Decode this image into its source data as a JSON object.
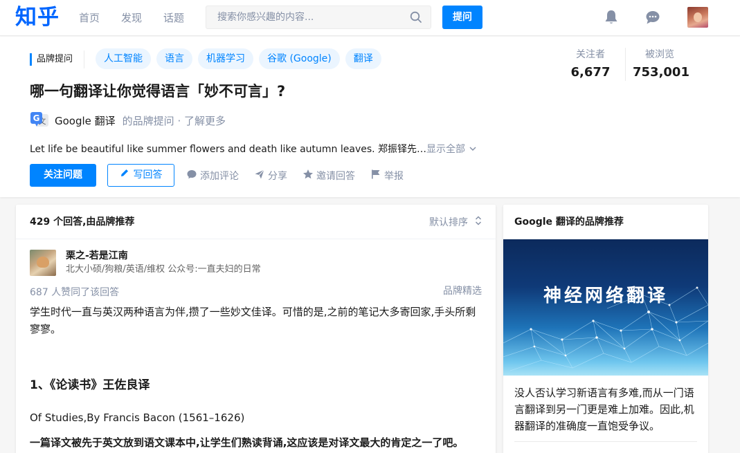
{
  "nav": {
    "logo": "知乎",
    "links": [
      "首页",
      "发现",
      "话题"
    ],
    "search_placeholder": "搜索你感兴趣的内容...",
    "ask_label": "提问"
  },
  "question": {
    "brand_tag": "品牌提问",
    "topics": [
      "人工智能",
      "语言",
      "机器学习",
      "谷歌 (Google)",
      "翻译"
    ],
    "title": "哪一句翻译让你觉得语言「妙不可言」?",
    "brand_name": "Google 翻译",
    "brand_note": "的品牌提问 · 了解更多",
    "excerpt": "Let life be beautiful like summer flowers and death like autumn leaves. 郑振铎先…",
    "show_all": "显示全部",
    "follow_label": "关注问题",
    "write_label": "写回答",
    "actions": [
      "添加评论",
      "分享",
      "邀请回答",
      "举报"
    ],
    "followers_label": "关注者",
    "followers_count": "6,677",
    "views_label": "被浏览",
    "views_count": "753,001"
  },
  "answers": {
    "count_text": "429 个回答,由品牌推荐",
    "sort_label": "默认排序",
    "author_name": "栗之-若是江南",
    "author_bio": "北大小硕/狗粮/英语/维权 公众号:一直夫妇的日常",
    "votes_text": "687 人赞同了该回答",
    "featured_label": "品牌精选",
    "paragraph1": "学生时代一直与英汉两种语言为伴,攒了一些妙文佳译。可惜的是,之前的笔记大多寄回家,手头所剩寥寥。",
    "heading1": "1、《论读书》王佐良译",
    "paragraph2": "Of Studies,By Francis Bacon (1561–1626)",
    "paragraph3": "一篇译文被先于英文放到语文课本中,让学生们熟读背诵,这应该是对译文最大的肯定之一了吧。"
  },
  "side": {
    "title": "Google 翻译的品牌推荐",
    "banner_text": "神经网络翻译",
    "description": "没人否认学习新语言有多难,而从一门语言翻译到另一门更是难上加难。因此,机器翻译的准确度一直饱受争议。"
  },
  "colors": {
    "brand_blue": "#0084ff",
    "logo_blue": "#0066ff",
    "muted_gray": "#8590a6",
    "topic_bg": "#ebf5ff"
  },
  "icons": {
    "search": "search-icon",
    "bell": "bell-icon",
    "chat": "chat-icon",
    "pencil": "pencil-icon",
    "comment": "comment-icon",
    "share": "share-icon",
    "invite": "star-icon",
    "report": "flag-icon",
    "sort": "sort-icon",
    "chevron": "chevron-down-icon"
  }
}
